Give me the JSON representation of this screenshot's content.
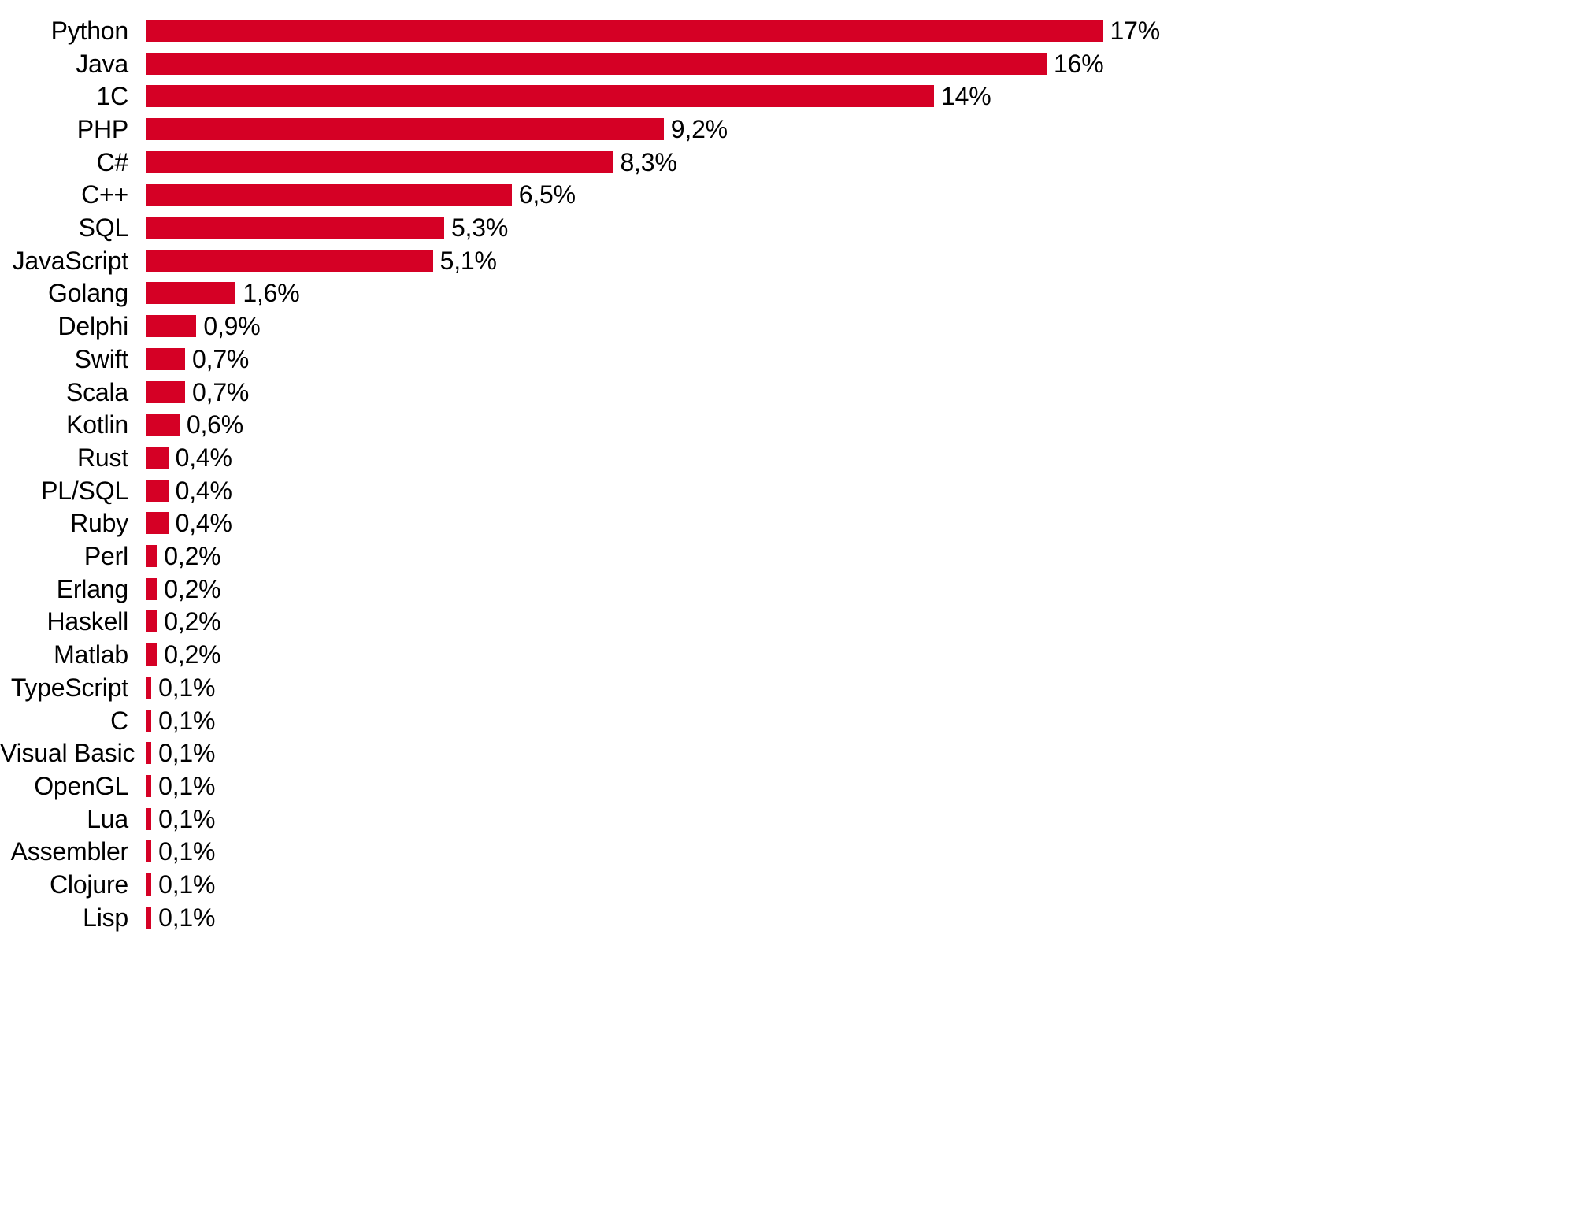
{
  "chart_data": {
    "type": "bar",
    "orientation": "horizontal",
    "title": "",
    "subtitle": "",
    "xlabel": "",
    "ylabel": "",
    "grid": false,
    "legend": null,
    "xlim": [
      0,
      17
    ],
    "units": "%",
    "decimal_separator": ",",
    "bar_color": "#D50025",
    "label_color": "#000000",
    "background_color": "#FFFFFF",
    "categories": [
      "Python",
      "Java",
      "1C",
      "PHP",
      "C#",
      "C++",
      "SQL",
      "JavaScript",
      "Golang",
      "Delphi",
      "Swift",
      "Scala",
      "Kotlin",
      "Rust",
      "PL/SQL",
      "Ruby",
      "Perl",
      "Erlang",
      "Haskell",
      "Matlab",
      "TypeScript",
      "C",
      "Visual Basic",
      "OpenGL",
      "Lua",
      "Assembler",
      "Clojure",
      "Lisp"
    ],
    "values": [
      17,
      16,
      14,
      9.2,
      8.3,
      6.5,
      5.3,
      5.1,
      1.6,
      0.9,
      0.7,
      0.7,
      0.6,
      0.4,
      0.4,
      0.4,
      0.2,
      0.2,
      0.2,
      0.2,
      0.1,
      0.1,
      0.1,
      0.1,
      0.1,
      0.1,
      0.1,
      0.1
    ],
    "value_labels": [
      "17%",
      "16%",
      "14%",
      "9,2%",
      "8,3%",
      "6,5%",
      "5,3%",
      "5,1%",
      "1,6%",
      "0,9%",
      "0,7%",
      "0,7%",
      "0,6%",
      "0,4%",
      "0,4%",
      "0,4%",
      "0,2%",
      "0,2%",
      "0,2%",
      "0,2%",
      "0,1%",
      "0,1%",
      "0,1%",
      "0,1%",
      "0,1%",
      "0,1%",
      "0,1%",
      "0,1%"
    ]
  }
}
